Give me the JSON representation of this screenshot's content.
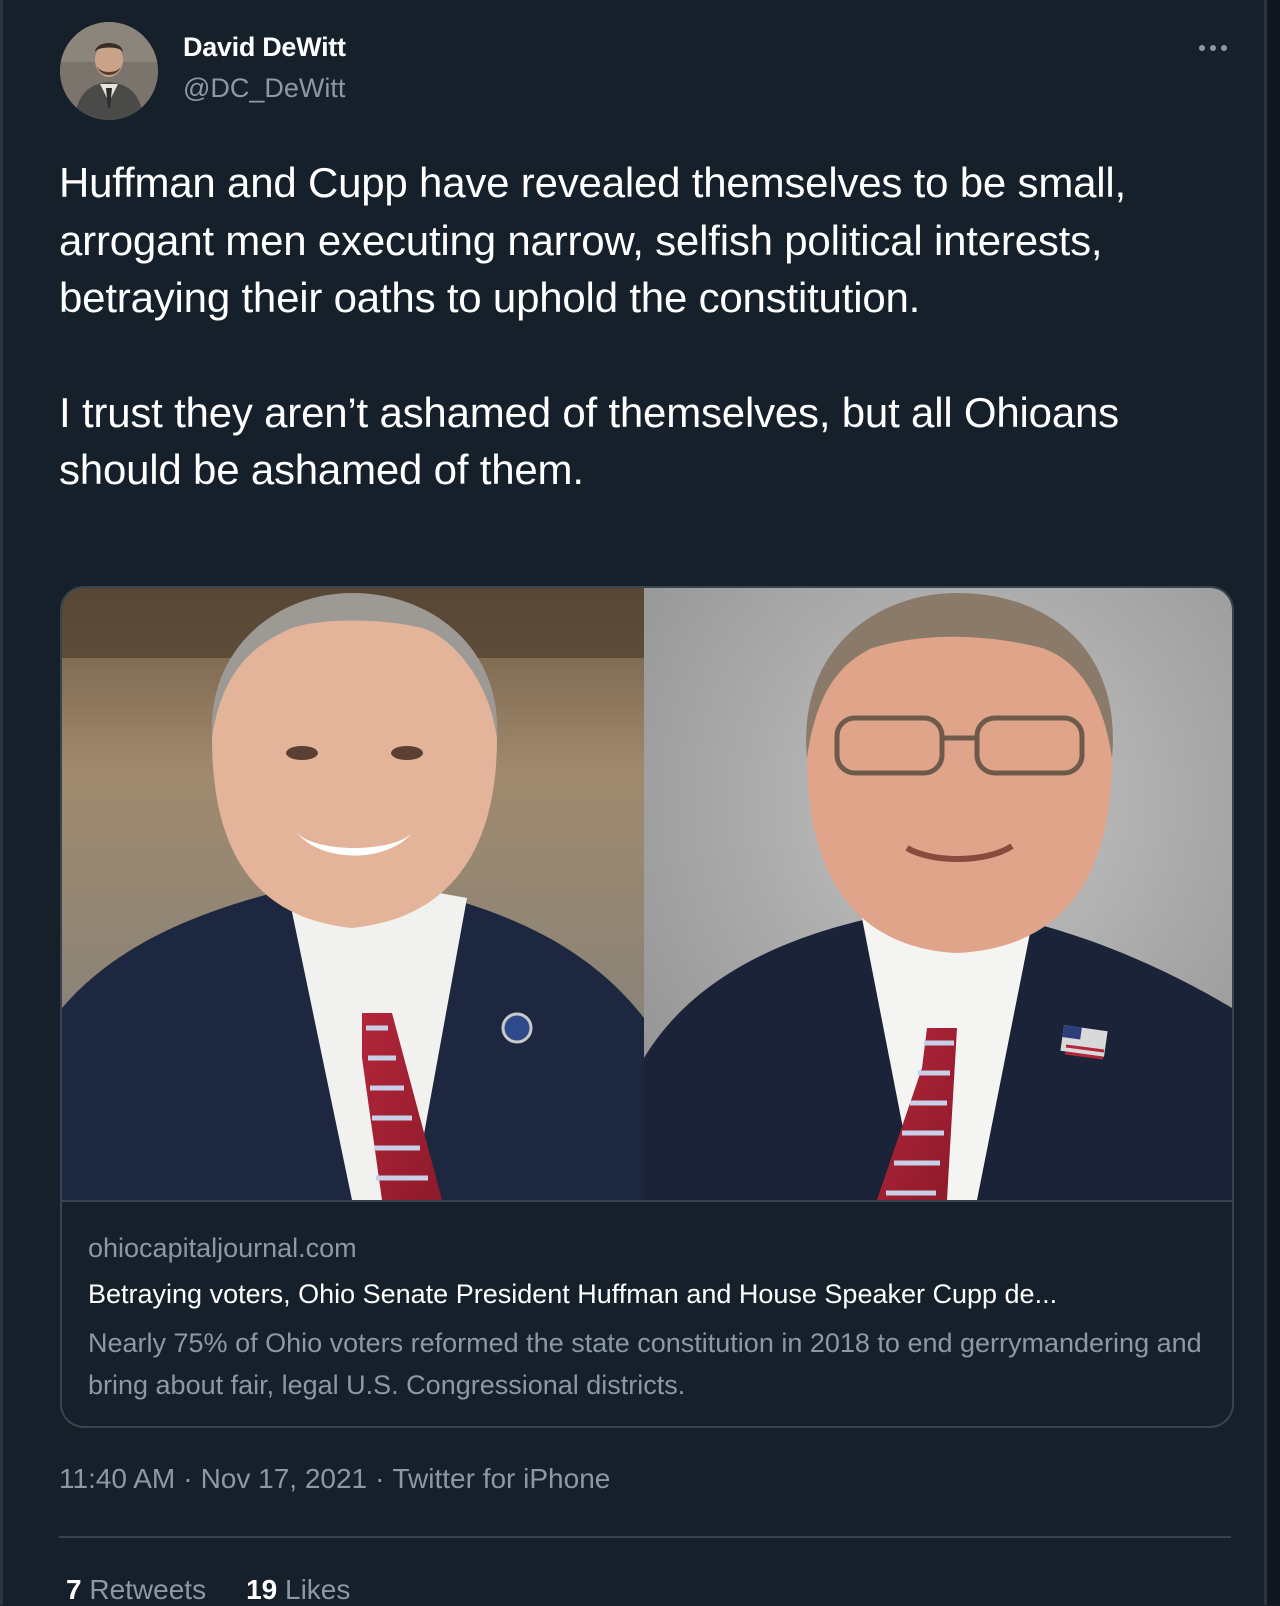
{
  "user": {
    "display_name": "David DeWitt",
    "handle": "@DC_DeWitt"
  },
  "tweet": {
    "paragraphs": [
      "Huffman and Cupp have revealed themselves to be small, arrogant men executing narrow, selfish political interests, betraying their oaths to uphold the constitution.",
      "I trust they aren’t ashamed of themselves, but all Ohioans should be ashamed of them."
    ]
  },
  "card": {
    "domain": "ohiocapitaljournal.com",
    "title": "Betraying voters, Ohio Senate President Huffman and House Speaker Cupp de...",
    "description": "Nearly 75% of Ohio voters reformed the state constitution in 2018 to end gerrymandering and bring about fair, legal U.S. Congressional districts."
  },
  "meta": {
    "time": "11:40 AM",
    "date": "Nov 17, 2021",
    "source": "Twitter for iPhone",
    "separator": "·"
  },
  "stats": {
    "retweets_count": "7",
    "retweets_label": "Retweets",
    "likes_count": "19",
    "likes_label": "Likes"
  },
  "icons": {
    "more": "more-horizontal-icon"
  },
  "colors": {
    "background": "#15202b",
    "text_primary": "#ffffff",
    "text_secondary": "#8b98a5",
    "border": "#38444d"
  }
}
